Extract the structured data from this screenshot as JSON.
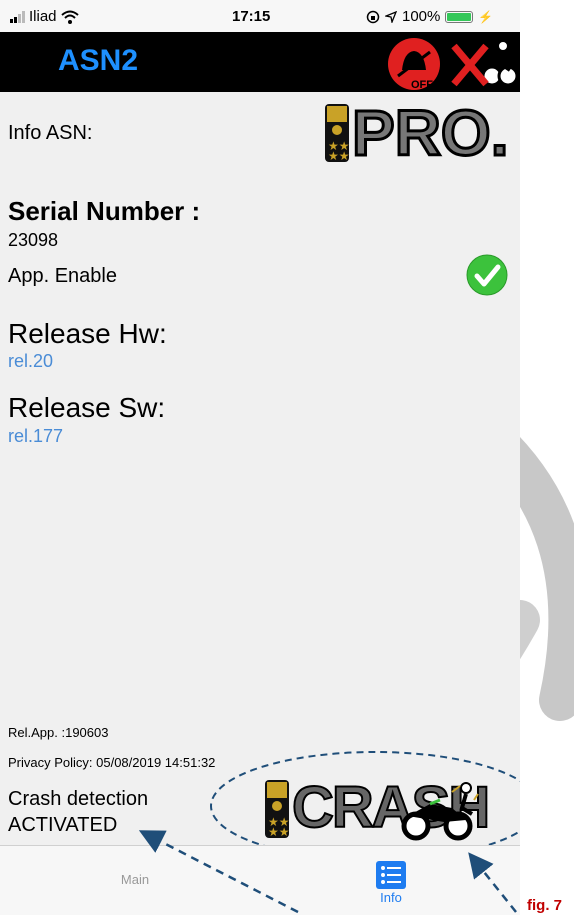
{
  "status_bar": {
    "carrier": "Iliad",
    "time": "17:15",
    "battery": "100%",
    "battery_level": 1.0,
    "icons": [
      "signal-icon",
      "wifi-icon",
      "rotation-lock-icon",
      "location-icon",
      "battery-icon",
      "charging-icon"
    ]
  },
  "header": {
    "title": "ASN2",
    "off_badge": "OFF"
  },
  "info": {
    "label": "Info ASN:",
    "pro_badge": "PRO.",
    "serial_heading": "Serial Number :",
    "serial_value": "23098",
    "app_enable_label": "App. Enable",
    "release_hw_heading": "Release Hw:",
    "release_hw_value": "rel.20",
    "release_sw_heading": "Release Sw:",
    "release_sw_value": "rel.177"
  },
  "footer": {
    "rel_app": "Rel.App. :190603",
    "privacy_policy": "Privacy Policy: 05/08/2019 14:51:32",
    "crash_line1": "Crash detection",
    "crash_line2": "ACTIVATED",
    "crash_badge": "CRASH"
  },
  "tabs": [
    {
      "label": "Main",
      "active": false
    },
    {
      "label": "Info",
      "active": true
    }
  ],
  "figure_label": "fig. 7",
  "colors": {
    "header_bg": "#000000",
    "title": "#1e90ff",
    "link": "#4a8cd6",
    "check": "#3cc23c",
    "annotation": "#1f4e79",
    "figure_label": "#c00000",
    "alarm_red": "#e02020"
  }
}
